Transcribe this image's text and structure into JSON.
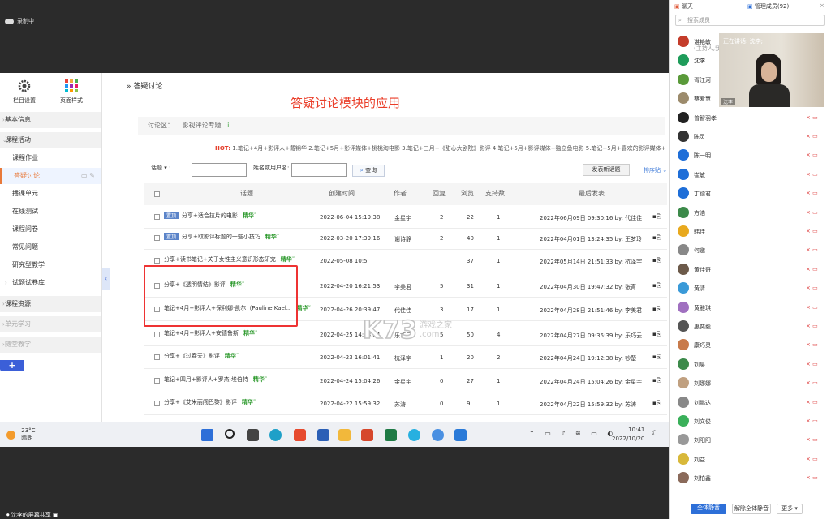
{
  "recording": {
    "label": "录制中"
  },
  "sidebar": {
    "top": [
      {
        "label": "栏目设置"
      },
      {
        "label": "页面样式"
      }
    ],
    "items": [
      {
        "label": "基本信息"
      },
      {
        "label": "课程活动"
      },
      {
        "label": "课程作业"
      },
      {
        "label": "答疑讨论"
      },
      {
        "label": "播课单元"
      },
      {
        "label": "在线测试"
      },
      {
        "label": "课程问卷"
      },
      {
        "label": "常见问题"
      },
      {
        "label": "研究型教学"
      },
      {
        "label": "试题试卷库"
      },
      {
        "label": "课程资源"
      },
      {
        "label": "单元学习"
      },
      {
        "label": "随堂教学"
      }
    ],
    "add": "+"
  },
  "main": {
    "breadcrumb": "» 答疑讨论",
    "overlay_title": "答疑讨论模块的应用",
    "topic_label": "讨论区：",
    "topic_name": "影视评论专题",
    "topic_icon": "i",
    "hot_label": "HOT:",
    "hot_items": "1.笔记+4月+影评人+戴锦华    2.笔记+5月+影评媒体+桃桃淘电影    3.笔记+三月+《甜心大剧院》影评    4.笔记+5月+影评媒体+独立鱼电影    5.笔记+5月+喜欢的影评媒体+",
    "filter_select": "话题",
    "filter_user_label": "姓名或用户名:",
    "search_label": "查询",
    "new_topic_label": "发表新话题",
    "sort_label": "排序贴"
  },
  "table": {
    "headers": [
      "话题",
      "创建时间",
      "作者",
      "回复",
      "浏览",
      "支持数",
      "最后发表"
    ],
    "tag": "置顶",
    "essence": "精华˜",
    "rows": [
      {
        "title": "分享+适合拉片的电影",
        "time": "2022-06-04 15:19:38",
        "author": "金星宇",
        "reply": "2",
        "views": "22",
        "support": "1",
        "last": "2022年06月09日 09:30:16  by: 代佳佳"
      },
      {
        "title": "分享+取影评标题的一些小技巧",
        "time": "2022-03-20 17:39:16",
        "author": "谢诗静",
        "reply": "2",
        "views": "40",
        "support": "1",
        "last": "2022年04月01日 13:24:35  by: 王梦玲"
      },
      {
        "title": "分享+读书笔记+关于女性主义意识形态研究",
        "time": "2022-05-08 10:5",
        "author": "",
        "reply": "",
        "views": "37",
        "support": "1",
        "last": "2022年05月14日 21:51:33  by: 杭泽宇"
      },
      {
        "title": "分享+《透明情结》影评",
        "time": "2022-04-20 16:21:53",
        "author": "李美君",
        "reply": "5",
        "views": "31",
        "support": "1",
        "last": "2022年04月30日 19:47:32  by: 张宵"
      },
      {
        "title": "笔记+4月+影评人+保利娜·凯尔（Pauline Kael...",
        "time": "2022-04-26 20:39:47",
        "author": "代佳佳",
        "reply": "3",
        "views": "17",
        "support": "1",
        "last": "2022年04月28日 21:51:46  by: 李美君"
      },
      {
        "title": "笔记+4月+影评人+安德鲁斯",
        "time": "2022-04-25 14:28:24",
        "author": "乐巧云",
        "reply": "5",
        "views": "50",
        "support": "4",
        "last": "2022年04月27日 09:35:39  by: 乐巧云"
      },
      {
        "title": "分享+《过春天》影评",
        "time": "2022-04-23 16:01:41",
        "author": "杭泽宇",
        "reply": "1",
        "views": "20",
        "support": "2",
        "last": "2022年04月24日 19:12:38  by: 钞楚"
      },
      {
        "title": "笔记+四月+影评人+罗杰·埃伯特",
        "time": "2022-04-24 15:04:26",
        "author": "金星宇",
        "reply": "0",
        "views": "27",
        "support": "1",
        "last": "2022年04月24日 15:04:26  by: 金星宇"
      },
      {
        "title": "分享+《艾米丽闯巴黎》影评",
        "time": "2022-04-22 15:59:32",
        "author": "苏涛",
        "reply": "0",
        "views": "9",
        "support": "1",
        "last": "2022年04月22日 15:59:32  by: 苏涛"
      }
    ]
  },
  "watermark": {
    "main": "K73",
    "sub": "游戏之家",
    "domain": ".com"
  },
  "taskbar": {
    "temp": "23°C",
    "weather": "晴朗",
    "time": "10:41",
    "date": "2022/10/20"
  },
  "share_status": "沈李的屏幕共享",
  "panel": {
    "tab_chat": "聊天",
    "tab_members": "管理成员(92)",
    "search_placeholder": "搜索成员",
    "speaking": "正在讲话: 沈李;",
    "video_name": "沈李",
    "members": [
      {
        "name": "谌艳敏",
        "sub": "(主持人,我)",
        "color": "#c43c2a"
      },
      {
        "name": "沈李",
        "color": "#1e9c5a"
      },
      {
        "name": "胥江河",
        "color": "#5a9a3a"
      },
      {
        "name": "蔡爱慧",
        "color": "#9c8b6c"
      },
      {
        "name": "曾智羽孝",
        "color": "#222222"
      },
      {
        "name": "陈灵",
        "color": "#333333"
      },
      {
        "name": "陈一明",
        "color": "#1e6ed8"
      },
      {
        "name": "崔敏",
        "color": "#1e6ed8"
      },
      {
        "name": "丁德君",
        "color": "#1e6ed8"
      },
      {
        "name": "方浩",
        "color": "#3c8a4a"
      },
      {
        "name": "韩佳",
        "color": "#e8a91e"
      },
      {
        "name": "何邈",
        "color": "#888888"
      },
      {
        "name": "黄佳奇",
        "color": "#6c5a4a"
      },
      {
        "name": "黄清",
        "color": "#3a9ad8"
      },
      {
        "name": "黄雅琪",
        "color": "#a070c0"
      },
      {
        "name": "惠奕毅",
        "color": "#555555"
      },
      {
        "name": "康巧灵",
        "color": "#c87a4a"
      },
      {
        "name": "刘昊",
        "color": "#3c8a4a"
      },
      {
        "name": "刘娜娜",
        "color": "#c0a080"
      },
      {
        "name": "刘鹏达",
        "color": "#888888"
      },
      {
        "name": "刘文俊",
        "color": "#3ab05a"
      },
      {
        "name": "刘阳阳",
        "color": "#999999"
      },
      {
        "name": "刘益",
        "color": "#d8b83a"
      },
      {
        "name": "刘柏鑫",
        "color": "#8a6a5a"
      }
    ],
    "mute_all": "全体静音",
    "unmute_all": "解除全体静音",
    "more": "更多"
  }
}
